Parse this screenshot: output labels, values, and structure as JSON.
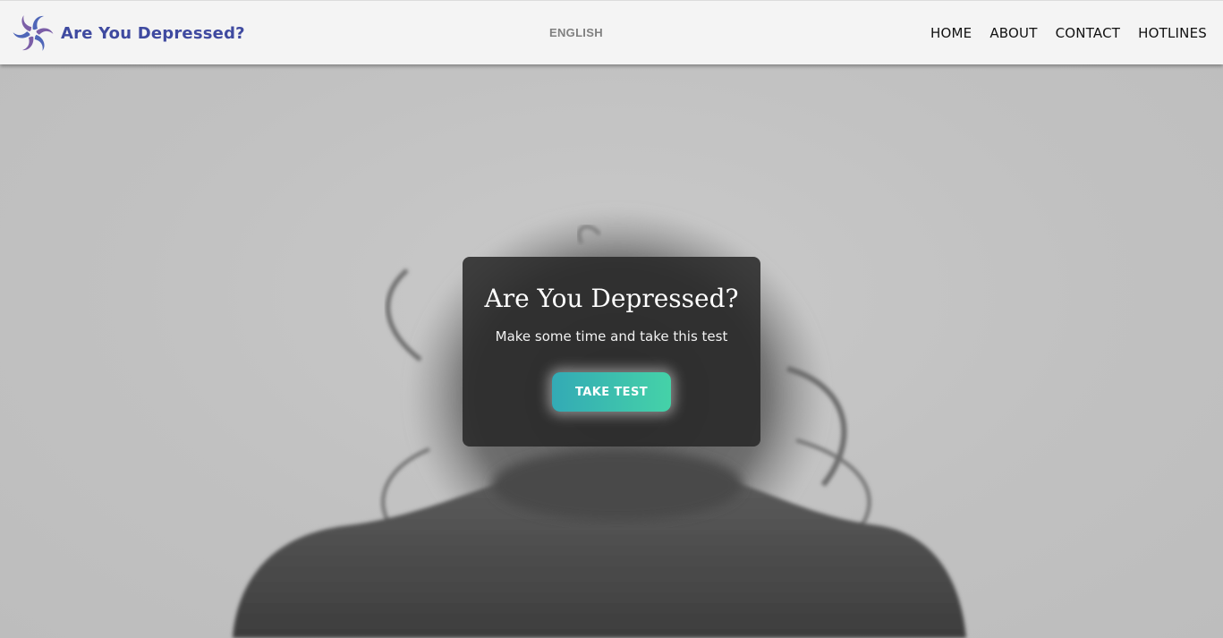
{
  "nav": {
    "brand": "Are You Depressed?",
    "language": "ENGLISH",
    "links": [
      "HOME",
      "ABOUT",
      "CONTACT",
      "HOTLINES"
    ]
  },
  "hero": {
    "title": "Are You Depressed?",
    "subtitle": "Make some time and take this test",
    "button": "TAKE TEST"
  },
  "icons": {
    "logo": "pinwheel-logo-icon"
  },
  "colors": {
    "brand": "#3f4aa0",
    "logo_purple": "#7b5ea7",
    "logo_blue": "#4f66b8",
    "button_start": "#33aab5",
    "button_end": "#45d2a8",
    "nav_bg": "#f4f4f4",
    "card_bg": "#262626"
  }
}
